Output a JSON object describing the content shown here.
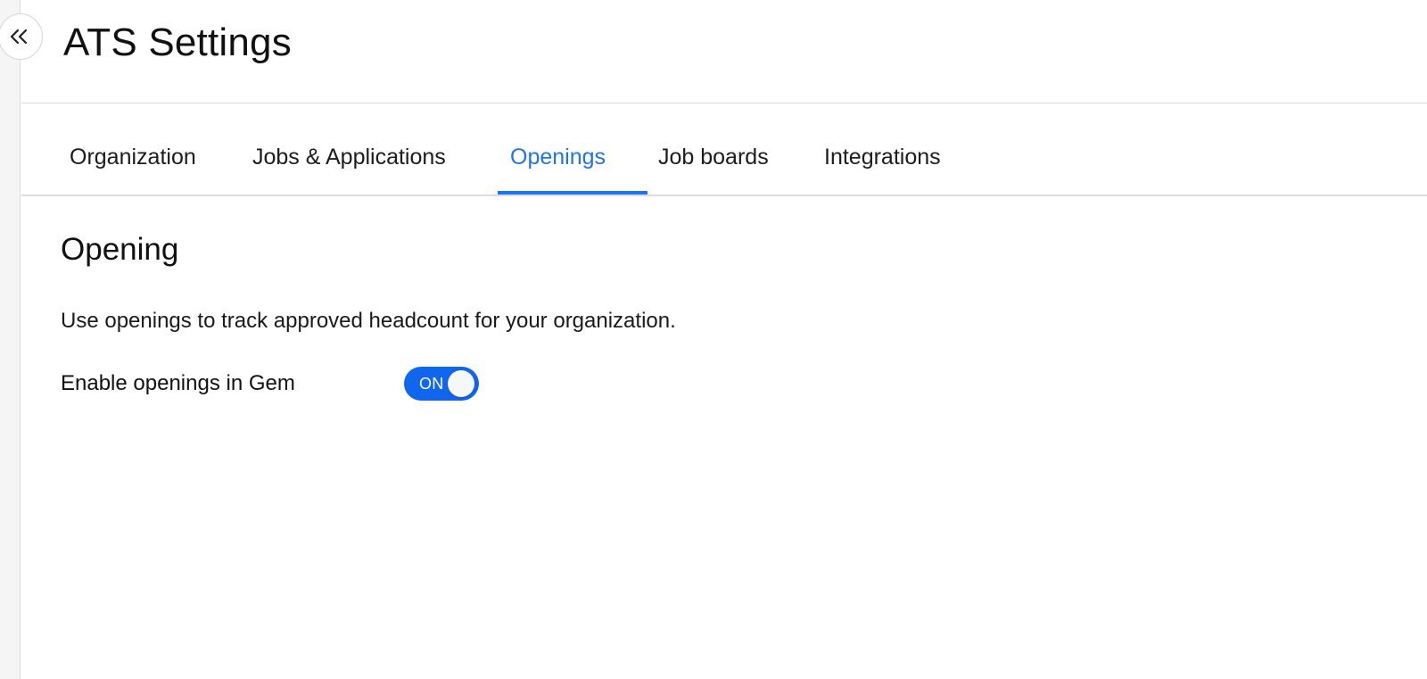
{
  "header": {
    "title": "ATS Settings"
  },
  "collapse_button": {
    "icon": "double-chevron-left-icon"
  },
  "tabs": [
    {
      "label": "Organization",
      "active": false
    },
    {
      "label": "Jobs & Applications",
      "active": false
    },
    {
      "label": "Openings",
      "active": true
    },
    {
      "label": "Job boards",
      "active": false
    },
    {
      "label": "Integrations",
      "active": false
    }
  ],
  "section": {
    "title": "Opening",
    "description": "Use openings to track approved headcount for your organization.",
    "toggle": {
      "label": "Enable openings in Gem",
      "state_text": "ON",
      "enabled": true
    }
  },
  "colors": {
    "accent": "#1f74e8",
    "toggle_on": "#1166f0",
    "divider": "#d9dde3"
  }
}
